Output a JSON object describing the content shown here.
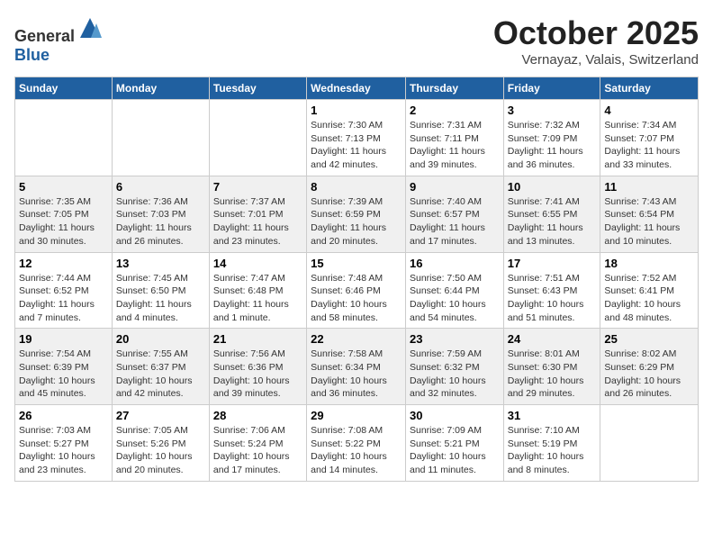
{
  "header": {
    "logo_general": "General",
    "logo_blue": "Blue",
    "month": "October 2025",
    "location": "Vernayaz, Valais, Switzerland"
  },
  "weekdays": [
    "Sunday",
    "Monday",
    "Tuesday",
    "Wednesday",
    "Thursday",
    "Friday",
    "Saturday"
  ],
  "weeks": [
    [
      {
        "day": "",
        "sunrise": "",
        "sunset": "",
        "daylight": ""
      },
      {
        "day": "",
        "sunrise": "",
        "sunset": "",
        "daylight": ""
      },
      {
        "day": "",
        "sunrise": "",
        "sunset": "",
        "daylight": ""
      },
      {
        "day": "1",
        "sunrise": "Sunrise: 7:30 AM",
        "sunset": "Sunset: 7:13 PM",
        "daylight": "Daylight: 11 hours and 42 minutes."
      },
      {
        "day": "2",
        "sunrise": "Sunrise: 7:31 AM",
        "sunset": "Sunset: 7:11 PM",
        "daylight": "Daylight: 11 hours and 39 minutes."
      },
      {
        "day": "3",
        "sunrise": "Sunrise: 7:32 AM",
        "sunset": "Sunset: 7:09 PM",
        "daylight": "Daylight: 11 hours and 36 minutes."
      },
      {
        "day": "4",
        "sunrise": "Sunrise: 7:34 AM",
        "sunset": "Sunset: 7:07 PM",
        "daylight": "Daylight: 11 hours and 33 minutes."
      }
    ],
    [
      {
        "day": "5",
        "sunrise": "Sunrise: 7:35 AM",
        "sunset": "Sunset: 7:05 PM",
        "daylight": "Daylight: 11 hours and 30 minutes."
      },
      {
        "day": "6",
        "sunrise": "Sunrise: 7:36 AM",
        "sunset": "Sunset: 7:03 PM",
        "daylight": "Daylight: 11 hours and 26 minutes."
      },
      {
        "day": "7",
        "sunrise": "Sunrise: 7:37 AM",
        "sunset": "Sunset: 7:01 PM",
        "daylight": "Daylight: 11 hours and 23 minutes."
      },
      {
        "day": "8",
        "sunrise": "Sunrise: 7:39 AM",
        "sunset": "Sunset: 6:59 PM",
        "daylight": "Daylight: 11 hours and 20 minutes."
      },
      {
        "day": "9",
        "sunrise": "Sunrise: 7:40 AM",
        "sunset": "Sunset: 6:57 PM",
        "daylight": "Daylight: 11 hours and 17 minutes."
      },
      {
        "day": "10",
        "sunrise": "Sunrise: 7:41 AM",
        "sunset": "Sunset: 6:55 PM",
        "daylight": "Daylight: 11 hours and 13 minutes."
      },
      {
        "day": "11",
        "sunrise": "Sunrise: 7:43 AM",
        "sunset": "Sunset: 6:54 PM",
        "daylight": "Daylight: 11 hours and 10 minutes."
      }
    ],
    [
      {
        "day": "12",
        "sunrise": "Sunrise: 7:44 AM",
        "sunset": "Sunset: 6:52 PM",
        "daylight": "Daylight: 11 hours and 7 minutes."
      },
      {
        "day": "13",
        "sunrise": "Sunrise: 7:45 AM",
        "sunset": "Sunset: 6:50 PM",
        "daylight": "Daylight: 11 hours and 4 minutes."
      },
      {
        "day": "14",
        "sunrise": "Sunrise: 7:47 AM",
        "sunset": "Sunset: 6:48 PM",
        "daylight": "Daylight: 11 hours and 1 minute."
      },
      {
        "day": "15",
        "sunrise": "Sunrise: 7:48 AM",
        "sunset": "Sunset: 6:46 PM",
        "daylight": "Daylight: 10 hours and 58 minutes."
      },
      {
        "day": "16",
        "sunrise": "Sunrise: 7:50 AM",
        "sunset": "Sunset: 6:44 PM",
        "daylight": "Daylight: 10 hours and 54 minutes."
      },
      {
        "day": "17",
        "sunrise": "Sunrise: 7:51 AM",
        "sunset": "Sunset: 6:43 PM",
        "daylight": "Daylight: 10 hours and 51 minutes."
      },
      {
        "day": "18",
        "sunrise": "Sunrise: 7:52 AM",
        "sunset": "Sunset: 6:41 PM",
        "daylight": "Daylight: 10 hours and 48 minutes."
      }
    ],
    [
      {
        "day": "19",
        "sunrise": "Sunrise: 7:54 AM",
        "sunset": "Sunset: 6:39 PM",
        "daylight": "Daylight: 10 hours and 45 minutes."
      },
      {
        "day": "20",
        "sunrise": "Sunrise: 7:55 AM",
        "sunset": "Sunset: 6:37 PM",
        "daylight": "Daylight: 10 hours and 42 minutes."
      },
      {
        "day": "21",
        "sunrise": "Sunrise: 7:56 AM",
        "sunset": "Sunset: 6:36 PM",
        "daylight": "Daylight: 10 hours and 39 minutes."
      },
      {
        "day": "22",
        "sunrise": "Sunrise: 7:58 AM",
        "sunset": "Sunset: 6:34 PM",
        "daylight": "Daylight: 10 hours and 36 minutes."
      },
      {
        "day": "23",
        "sunrise": "Sunrise: 7:59 AM",
        "sunset": "Sunset: 6:32 PM",
        "daylight": "Daylight: 10 hours and 32 minutes."
      },
      {
        "day": "24",
        "sunrise": "Sunrise: 8:01 AM",
        "sunset": "Sunset: 6:30 PM",
        "daylight": "Daylight: 10 hours and 29 minutes."
      },
      {
        "day": "25",
        "sunrise": "Sunrise: 8:02 AM",
        "sunset": "Sunset: 6:29 PM",
        "daylight": "Daylight: 10 hours and 26 minutes."
      }
    ],
    [
      {
        "day": "26",
        "sunrise": "Sunrise: 7:03 AM",
        "sunset": "Sunset: 5:27 PM",
        "daylight": "Daylight: 10 hours and 23 minutes."
      },
      {
        "day": "27",
        "sunrise": "Sunrise: 7:05 AM",
        "sunset": "Sunset: 5:26 PM",
        "daylight": "Daylight: 10 hours and 20 minutes."
      },
      {
        "day": "28",
        "sunrise": "Sunrise: 7:06 AM",
        "sunset": "Sunset: 5:24 PM",
        "daylight": "Daylight: 10 hours and 17 minutes."
      },
      {
        "day": "29",
        "sunrise": "Sunrise: 7:08 AM",
        "sunset": "Sunset: 5:22 PM",
        "daylight": "Daylight: 10 hours and 14 minutes."
      },
      {
        "day": "30",
        "sunrise": "Sunrise: 7:09 AM",
        "sunset": "Sunset: 5:21 PM",
        "daylight": "Daylight: 10 hours and 11 minutes."
      },
      {
        "day": "31",
        "sunrise": "Sunrise: 7:10 AM",
        "sunset": "Sunset: 5:19 PM",
        "daylight": "Daylight: 10 hours and 8 minutes."
      },
      {
        "day": "",
        "sunrise": "",
        "sunset": "",
        "daylight": ""
      }
    ]
  ]
}
